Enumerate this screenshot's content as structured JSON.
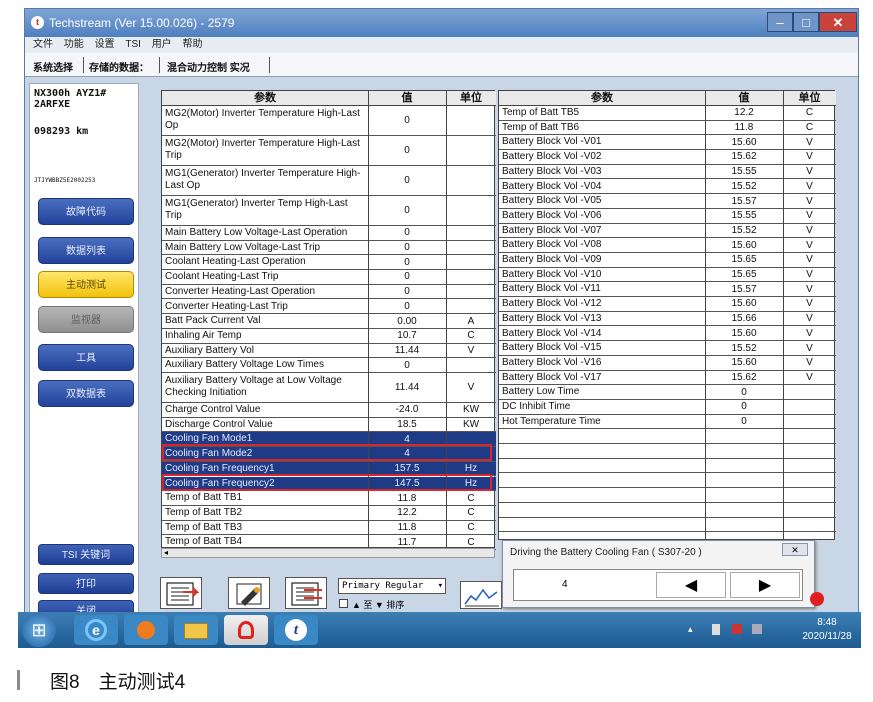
{
  "window": {
    "title": "Techstream (Ver 15.00.026) - 2579",
    "min": "–",
    "max": "□",
    "close": "✕",
    "app_icon": "t"
  },
  "menu": [
    "文件",
    "功能",
    "设置",
    "TSI",
    "用户",
    "帮助"
  ],
  "toolbar": {
    "system_select": "系统选择",
    "stored_data": "存储的数据：",
    "current": "混合动力控制 实况"
  },
  "vehicle": {
    "model": "NX300h AYZ1#",
    "engine": "2ARFXE",
    "odometer": "098293 km",
    "vin": "JTJYWBBZ5E2002253"
  },
  "nav": [
    {
      "label": "故障代码"
    },
    {
      "label": "数据列表"
    },
    {
      "label": "主动测试"
    },
    {
      "label": "监视器"
    },
    {
      "label": "工具"
    },
    {
      "label": "双数据表"
    }
  ],
  "bottom_buttons": {
    "tsi": "TSI 关键词",
    "print": "打印",
    "close": "关闭"
  },
  "table_headers": {
    "param": "参数",
    "value": "值",
    "unit": "单位"
  },
  "left_rows": [
    {
      "param": "MG2(Motor) Inverter Temperature High-Last Op",
      "value": "0",
      "unit": ""
    },
    {
      "param": "MG2(Motor) Inverter Temperature High-Last Trip",
      "value": "0",
      "unit": ""
    },
    {
      "param": "MG1(Generator) Inverter Temperature High-Last Op",
      "value": "0",
      "unit": ""
    },
    {
      "param": "MG1(Generator) Inverter Temp High-Last Trip",
      "value": "0",
      "unit": ""
    },
    {
      "param": "Main Battery Low Voltage-Last Operation",
      "value": "0",
      "unit": ""
    },
    {
      "param": "Main Battery Low Voltage-Last Trip",
      "value": "0",
      "unit": ""
    },
    {
      "param": "Coolant Heating-Last Operation",
      "value": "0",
      "unit": ""
    },
    {
      "param": "Coolant Heating-Last Trip",
      "value": "0",
      "unit": ""
    },
    {
      "param": "Converter Heating-Last Operation",
      "value": "0",
      "unit": ""
    },
    {
      "param": "Converter Heating-Last Trip",
      "value": "0",
      "unit": ""
    },
    {
      "param": "Batt Pack Current Val",
      "value": "0.00",
      "unit": "A"
    },
    {
      "param": "Inhaling Air Temp",
      "value": "10.7",
      "unit": "C"
    },
    {
      "param": "Auxiliary Battery Vol",
      "value": "11.44",
      "unit": "V"
    },
    {
      "param": "Auxiliary Battery Voltage Low Times",
      "value": "0",
      "unit": ""
    },
    {
      "param": "Auxiliary Battery Voltage at Low Voltage Checking Initiation",
      "value": "11.44",
      "unit": "V"
    },
    {
      "param": "Charge Control Value",
      "value": "-24.0",
      "unit": "KW"
    },
    {
      "param": "Discharge Control Value",
      "value": "18.5",
      "unit": "KW"
    },
    {
      "param": "Cooling Fan Mode1",
      "value": "4",
      "unit": ""
    },
    {
      "param": "Cooling Fan Mode2",
      "value": "4",
      "unit": ""
    },
    {
      "param": "Cooling Fan Frequency1",
      "value": "157.5",
      "unit": "Hz"
    },
    {
      "param": "Cooling Fan Frequency2",
      "value": "147.5",
      "unit": "Hz"
    },
    {
      "param": "Temp of Batt TB1",
      "value": "11.8",
      "unit": "C"
    },
    {
      "param": "Temp of Batt TB2",
      "value": "12.2",
      "unit": "C"
    },
    {
      "param": "Temp of Batt TB3",
      "value": "11.8",
      "unit": "C"
    },
    {
      "param": "Temp of Batt TB4",
      "value": "11.7",
      "unit": "C"
    }
  ],
  "right_rows": [
    {
      "param": "Temp of Batt TB5",
      "value": "12.2",
      "unit": "C"
    },
    {
      "param": "Temp of Batt TB6",
      "value": "11.8",
      "unit": "C"
    },
    {
      "param": "Battery Block Vol -V01",
      "value": "15.60",
      "unit": "V"
    },
    {
      "param": "Battery Block Vol -V02",
      "value": "15.62",
      "unit": "V"
    },
    {
      "param": "Battery Block Vol -V03",
      "value": "15.55",
      "unit": "V"
    },
    {
      "param": "Battery Block Vol -V04",
      "value": "15.52",
      "unit": "V"
    },
    {
      "param": "Battery Block Vol -V05",
      "value": "15.57",
      "unit": "V"
    },
    {
      "param": "Battery Block Vol -V06",
      "value": "15.55",
      "unit": "V"
    },
    {
      "param": "Battery Block Vol -V07",
      "value": "15.52",
      "unit": "V"
    },
    {
      "param": "Battery Block Vol -V08",
      "value": "15.60",
      "unit": "V"
    },
    {
      "param": "Battery Block Vol -V09",
      "value": "15.65",
      "unit": "V"
    },
    {
      "param": "Battery Block Vol -V10",
      "value": "15.65",
      "unit": "V"
    },
    {
      "param": "Battery Block Vol -V11",
      "value": "15.57",
      "unit": "V"
    },
    {
      "param": "Battery Block Vol -V12",
      "value": "15.60",
      "unit": "V"
    },
    {
      "param": "Battery Block Vol -V13",
      "value": "15.66",
      "unit": "V"
    },
    {
      "param": "Battery Block Vol -V14",
      "value": "15.60",
      "unit": "V"
    },
    {
      "param": "Battery Block Vol -V15",
      "value": "15.52",
      "unit": "V"
    },
    {
      "param": "Battery Block Vol -V16",
      "value": "15.60",
      "unit": "V"
    },
    {
      "param": "Battery Block Vol -V17",
      "value": "15.62",
      "unit": "V"
    },
    {
      "param": "Battery Low Time",
      "value": "0",
      "unit": ""
    },
    {
      "param": "DC Inhibit Time",
      "value": "0",
      "unit": ""
    },
    {
      "param": "Hot Temperature Time",
      "value": "0",
      "unit": ""
    }
  ],
  "controls": {
    "primary_select": "Primary Regular",
    "checkbox_label": "▲ 至 ▼ 排序"
  },
  "popup": {
    "title": "Driving the Battery Cooling Fan  ( S307-20 )",
    "value": "4",
    "close": "✕",
    "prev": "◀",
    "next": "▶"
  },
  "taskbar": {
    "time": "8:48",
    "date": "2020/11/28",
    "start": "⊞",
    "techstream": "t"
  },
  "caption": "图8　主动测试4",
  "colors": {
    "highlight_row": "#1f3b86",
    "highlight_box": "#d8262c",
    "nav_blue": "#22429a",
    "nav_active": "#f2c20c"
  }
}
